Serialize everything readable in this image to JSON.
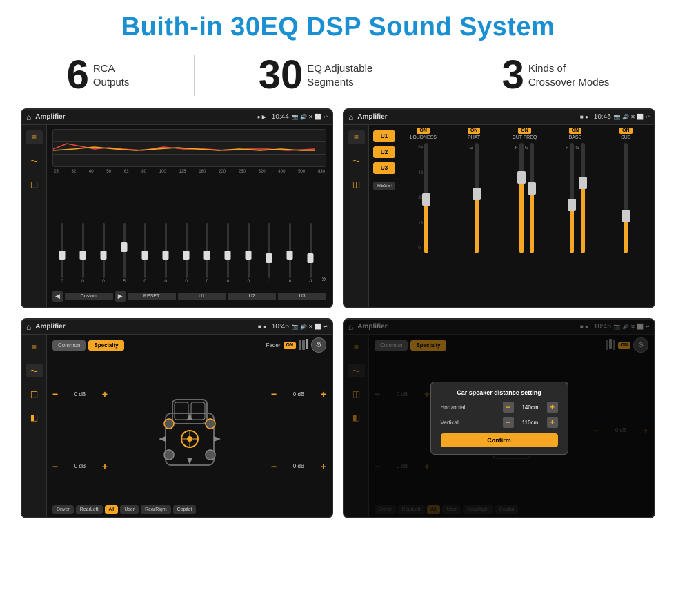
{
  "title": "Buith-in 30EQ DSP Sound System",
  "stats": [
    {
      "number": "6",
      "label": "RCA\nOutputs"
    },
    {
      "number": "30",
      "label": "EQ Adjustable\nSegments"
    },
    {
      "number": "3",
      "label": "Kinds of\nCrossover Modes"
    }
  ],
  "screens": {
    "eq": {
      "title": "Amplifier",
      "time": "10:44",
      "frequencies": [
        "25",
        "32",
        "40",
        "50",
        "63",
        "80",
        "100",
        "125",
        "160",
        "200",
        "250",
        "320",
        "400",
        "500",
        "630"
      ],
      "values": [
        "0",
        "0",
        "0",
        "5",
        "0",
        "0",
        "0",
        "0",
        "0",
        "0",
        "-1",
        "0",
        "-1"
      ],
      "bottom_buttons": [
        "Custom",
        "RESET",
        "U1",
        "U2",
        "U3"
      ]
    },
    "crossover": {
      "title": "Amplifier",
      "time": "10:45",
      "presets": [
        "U1",
        "U2",
        "U3"
      ],
      "sections": [
        "LOUDNESS",
        "PHAT",
        "CUT FREQ",
        "BASS",
        "SUB"
      ],
      "reset_label": "RESET"
    },
    "fader": {
      "title": "Amplifier",
      "time": "10:46",
      "tabs": [
        "Common",
        "Specialty"
      ],
      "fader_label": "Fader",
      "on_label": "ON",
      "bottom_buttons": [
        "Driver",
        "RearLeft",
        "All",
        "User",
        "RearRight",
        "Copilot"
      ],
      "db_values": [
        "0 dB",
        "0 dB",
        "0 dB",
        "0 dB"
      ]
    },
    "distance": {
      "title": "Amplifier",
      "time": "10:46",
      "tabs": [
        "Common",
        "Specialty"
      ],
      "dialog": {
        "title": "Car speaker distance setting",
        "horizontal_label": "Horizontal",
        "horizontal_value": "140cm",
        "vertical_label": "Vertical",
        "vertical_value": "110cm",
        "confirm_label": "Confirm"
      },
      "db_values": [
        "0 dB",
        "0 dB"
      ],
      "bottom_buttons": [
        "Driver",
        "RearLeft",
        "All",
        "User",
        "RearRight",
        "Copilot"
      ]
    }
  }
}
